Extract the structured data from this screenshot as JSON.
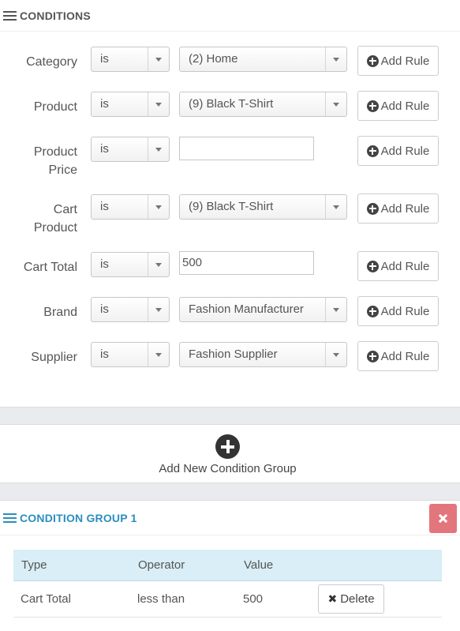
{
  "conditions": {
    "title": "CONDITIONS",
    "add_rule_label": "Add Rule",
    "rules": [
      {
        "label": "Category",
        "operator": "is",
        "value": "(2) Home",
        "value_type": "select"
      },
      {
        "label": "Product",
        "operator": "is",
        "value": "(9) Black T-Shirt",
        "value_type": "select"
      },
      {
        "label": "Product Price",
        "operator": "is",
        "value": "",
        "value_type": "input"
      },
      {
        "label": "Cart Product",
        "operator": "is",
        "value": "(9) Black T-Shirt",
        "value_type": "select"
      },
      {
        "label": "Cart Total",
        "operator": "is",
        "value": "500",
        "value_type": "input"
      },
      {
        "label": "Brand",
        "operator": "is",
        "value": "Fashion Manufacturer",
        "value_type": "select"
      },
      {
        "label": "Supplier",
        "operator": "is",
        "value": "Fashion Supplier",
        "value_type": "select"
      }
    ]
  },
  "add_group": {
    "label": "Add New Condition Group",
    "icon": "plus-circle-icon"
  },
  "group": {
    "title": "CONDITION GROUP 1",
    "close_icon": "close-icon",
    "columns": [
      "Type",
      "Operator",
      "Value"
    ],
    "rows": [
      {
        "type": "Cart Total",
        "operator": "less than",
        "value": "500",
        "delete_label": "Delete"
      }
    ]
  },
  "colors": {
    "accent": "#2a8fbd",
    "header_bg": "#d9eef6",
    "danger": "#e3767c"
  }
}
